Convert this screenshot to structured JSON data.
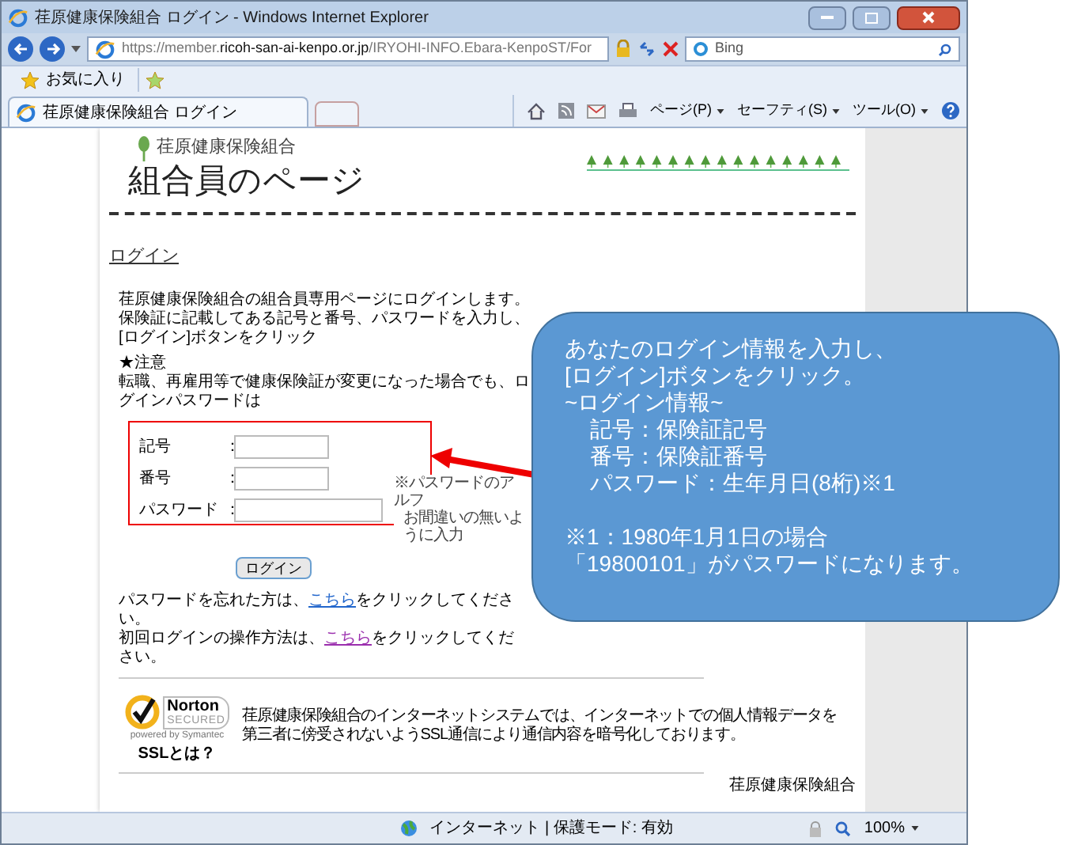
{
  "window": {
    "title": "荏原健康保険組合 ログイン - Windows Internet Explorer"
  },
  "address_bar": {
    "url_parts": [
      {
        "text": "https://",
        "kind": "dim"
      },
      {
        "text": "member.",
        "kind": "dim"
      },
      {
        "text": "ricoh-san-ai-kenpo.or.jp",
        "kind": "host"
      },
      {
        "text": "/IRYOHI-INFO.Ebara-KenpoST/For",
        "kind": "dim"
      }
    ]
  },
  "search": {
    "placeholder": "Bing"
  },
  "favorites": {
    "label": "お気に入り"
  },
  "tabs": [
    {
      "label": "荏原健康保険組合 ログイン",
      "selected": true
    }
  ],
  "commands": [
    "ページ(P)",
    "セーフティ(S)",
    "ツール(O)"
  ],
  "page": {
    "org_name": "荏原健康保険組合",
    "title": "組合員のページ",
    "heading": "ログイン",
    "intro": [
      "荏原健康保険組合の組合員専用ページにログインします。",
      "保険証に記載してある記号と番号、パスワードを入力し、[ログイン]ボタンをクリック"
    ],
    "notice_title": "★注意",
    "notice": "転職、再雇用等で健康保険証が変更になった場合でも、ログインパスワードは",
    "form": {
      "separator": "：",
      "fields": [
        {
          "label": "記号",
          "kind": "short"
        },
        {
          "label": "番号",
          "kind": "short"
        },
        {
          "label": "パスワード",
          "kind": "long"
        }
      ],
      "note": [
        "※パスワードのアルフ",
        "お間違いの無いように入力"
      ],
      "button": "ログイン"
    },
    "help": [
      {
        "before": "パスワードを忘れた方は、",
        "link": "こちら",
        "after": "をクリックしてください。",
        "visited": false
      },
      {
        "before": "初回ログインの操作方法は、",
        "link": "こちら",
        "after": "をクリックしてください。",
        "visited": true
      }
    ],
    "seal": {
      "brand": "Norton",
      "status": "SECURED",
      "powered": "powered by Symantec",
      "link": "SSLとは？"
    },
    "ssl_text": [
      "荏原健康保険組合のインターネットシステムでは、インターネットでの個人情報データを",
      "第三者に傍受されないようSSL通信により通信内容を暗号化しております。"
    ],
    "footer": "荏原健康保険組合"
  },
  "status_bar": {
    "zone": "インターネット | 保護モード: 有効",
    "zoom": "100%"
  },
  "callout": {
    "lines": [
      {
        "text": "あなたのログイン情報を入力し、",
        "kind": "plain"
      },
      {
        "text": "[ログイン]ボタンをクリック。",
        "kind": "plain"
      },
      {
        "text": "~ログイン情報~",
        "kind": "plain"
      },
      {
        "text": "記号：保険証記号",
        "kind": "indent"
      },
      {
        "text": "番号：保険証番号",
        "kind": "indent"
      },
      {
        "text": "パスワード：生年月日(8桁)※1",
        "kind": "indent"
      },
      {
        "text": "※1：1980年1月1日の場合",
        "kind": "note"
      },
      {
        "text": "「19800101」がパスワードになります。",
        "kind": "plain"
      }
    ]
  }
}
